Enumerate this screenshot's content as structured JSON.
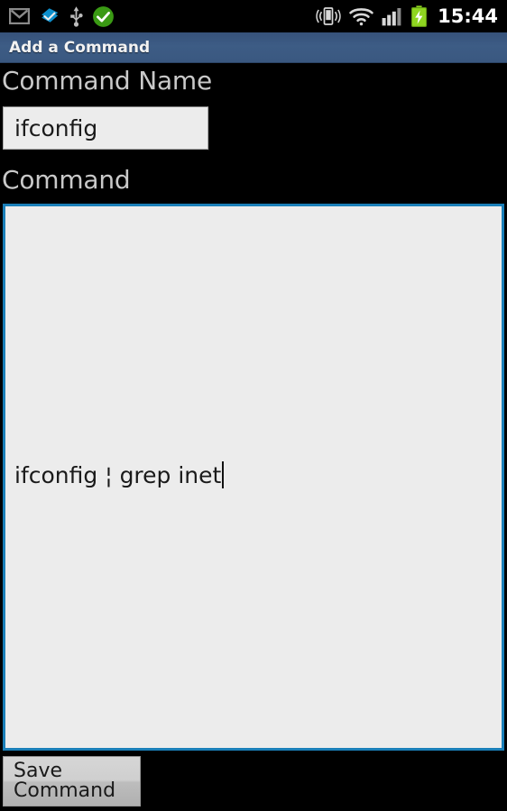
{
  "status_bar": {
    "left_icons": [
      {
        "name": "gmail-icon",
        "label": "Gmail notification",
        "color": "#8a8a8a"
      },
      {
        "name": "pocket-check-icon",
        "label": "App sync check",
        "color": "#0d8fcc"
      },
      {
        "name": "usb-icon",
        "label": "USB connected",
        "color": "#bdbdbd"
      },
      {
        "name": "check-circle-icon",
        "label": "Task complete",
        "color": "#3a9a14"
      }
    ],
    "right_icons": [
      {
        "name": "vibrate-icon",
        "label": "Vibrate mode",
        "color": "#d8d8d8"
      },
      {
        "name": "wifi-icon",
        "label": "Wi-Fi signal",
        "color": "#d8d8d8"
      },
      {
        "name": "cellular-signal-icon",
        "label": "Cellular signal",
        "color": "#d8d8d8"
      },
      {
        "name": "battery-charging-icon",
        "label": "Battery charging",
        "color": "#8fd620"
      }
    ],
    "clock": "15:44"
  },
  "title_bar": {
    "title": "Add a Command",
    "background_color": "#3b5a80",
    "text_color": "#f2f2f2"
  },
  "form": {
    "command_name_label": "Command Name",
    "command_name_value": "ifconfig",
    "command_name_placeholder": "",
    "command_label": "Command",
    "command_value": "ifconfig ¦ grep inet",
    "command_placeholder": "",
    "command_field_focused": true,
    "command_field_border_color": "#1a7fb8",
    "field_background_color": "#ececec",
    "label_color": "#c9c9c9"
  },
  "actions": {
    "save_label": "Save Command"
  }
}
